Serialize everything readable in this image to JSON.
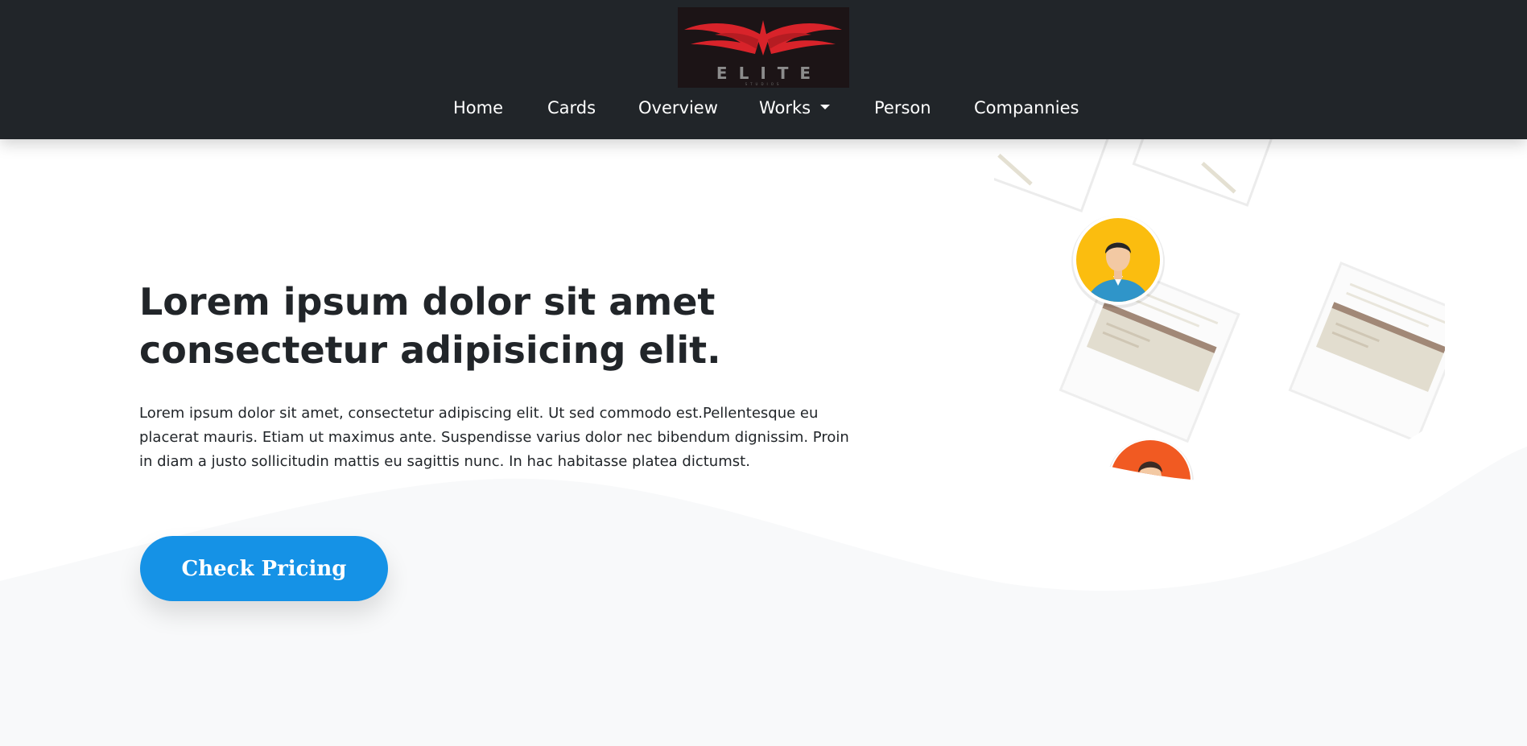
{
  "brand": {
    "logo_text": "ELITE",
    "logo_subtext": "STUDIOS"
  },
  "nav": {
    "items": [
      {
        "label": "Home"
      },
      {
        "label": "Cards"
      },
      {
        "label": "Overview"
      },
      {
        "label": "Works"
      },
      {
        "label": "Person"
      },
      {
        "label": "Compannies"
      }
    ]
  },
  "hero": {
    "title": "Lorem ipsum dolor sit amet consectetur adipisicing elit.",
    "text": "Lorem ipsum dolor sit amet, consectetur adipiscing elit. Ut sed commodo est.Pellentesque eu placerat mauris. Etiam ut maximus ante. Suspendisse varius dolor nec bibendum dignissim. Proin in diam a justo sollicitudin mattis eu sagittis nunc. In hac habitasse platea dictumst.",
    "cta_label": "Check Pricing"
  },
  "colors": {
    "navbar_bg": "#212529",
    "accent": "#1592e6",
    "logo_red": "#d8232a",
    "wave_bg": "#f8f9fa"
  },
  "icons": {
    "logo": "wings-logo-icon",
    "dropdown": "caret-down-icon",
    "avatar_1": "person-avatar-icon",
    "avatar_2": "person-avatar-icon"
  }
}
